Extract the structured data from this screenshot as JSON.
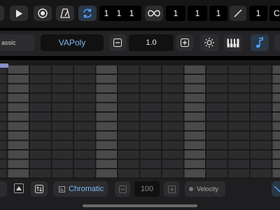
{
  "toolbar": {
    "position": "1 1 1",
    "cycle_bar": "1",
    "cycle_beat": "1",
    "cycle_div": "1",
    "length_bar": "1",
    "length_partial": "C"
  },
  "instrument": {
    "category_partial": "assic",
    "name": "VAPoly",
    "value": "1.0"
  },
  "grid": {
    "cols": 16,
    "rows": 12,
    "highlight_cols": [
      1,
      5,
      9,
      13
    ]
  },
  "bottom": {
    "scale": "Chromatic",
    "velocity_value": "100",
    "velocity_label": "Velocity"
  },
  "colors": {
    "accent_blue": "#4aa3ff",
    "cell_dark": "#2c2c2e",
    "cell_light": "#4a4a4c"
  }
}
